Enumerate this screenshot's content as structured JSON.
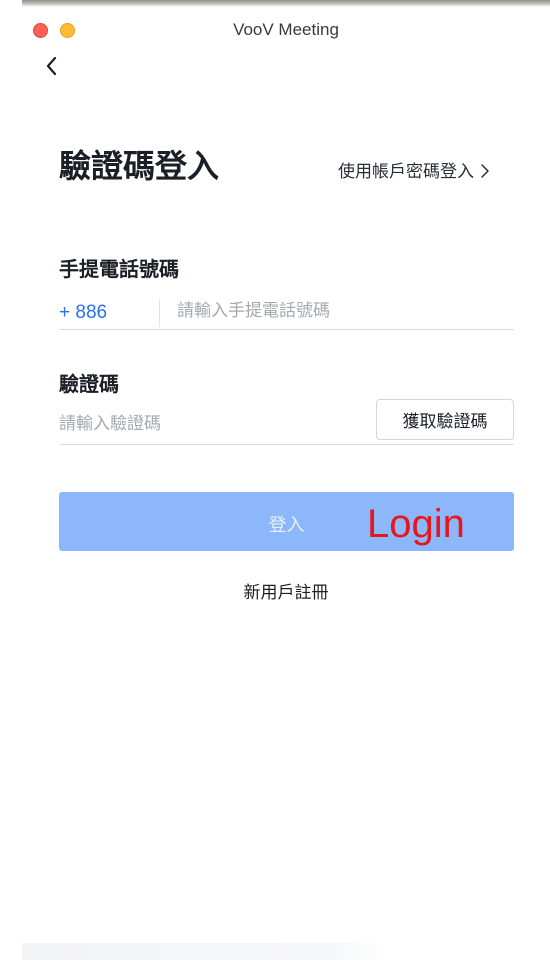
{
  "window": {
    "title": "VooV Meeting"
  },
  "header": {
    "title": "驗證碼登入",
    "switch_link": "使用帳戶密碼登入"
  },
  "phone": {
    "label": "手提電話號碼",
    "country_code": "+ 886",
    "placeholder": "請輸入手提電話號碼",
    "value": ""
  },
  "code": {
    "label": "驗證碼",
    "placeholder": "請輸入驗證碼",
    "value": "",
    "get_code_label": "獲取驗證碼"
  },
  "login": {
    "label": "登入",
    "annotation": "Login"
  },
  "register": {
    "label": "新用戶註冊"
  },
  "icons": {
    "back": "chevron-left-icon",
    "switch": "chevron-right-icon"
  },
  "colors": {
    "accent": "#2a6ef2",
    "login_button": "#8cb7fb",
    "annotation": "#e8151b",
    "close_light": "#fe5f57",
    "minimize_light": "#febc2e"
  }
}
